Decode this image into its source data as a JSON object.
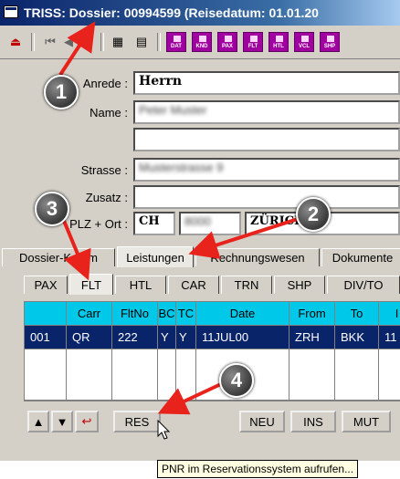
{
  "window": {
    "title": "TRISS: Dossier: 00994599 (Reisedatum: 01.01.20"
  },
  "toolbar": {
    "module_buttons": [
      "DAT",
      "KND",
      "PAX",
      "FLT",
      "HTL",
      "VCL",
      "SHP"
    ]
  },
  "form": {
    "anrede_label": "Anrede :",
    "anrede_value": "Herrn",
    "name_label": "Name :",
    "name_value": "Peter Muster",
    "name2_value": "",
    "strasse_label": "Strasse :",
    "strasse_value": "Musterstrasse 9",
    "zusatz_label": "Zusatz :",
    "zusatz_value": "",
    "plzort_label": "PLZ + Ort :",
    "country_value": "CH",
    "plz_value": "8000",
    "ort_value": "ZÜRICH"
  },
  "main_tabs": [
    "Dossier-Komm",
    "Leistungen",
    "Rechnungswesen",
    "Dokumente"
  ],
  "sub_tabs": [
    "PAX",
    "FLT",
    "HTL",
    "CAR",
    "TRN",
    "SHP",
    "DIV/TO"
  ],
  "grid": {
    "columns": [
      "",
      "Carr",
      "FltNo",
      "BC",
      "TC",
      "Date",
      "From",
      "To",
      "I"
    ],
    "rows": [
      [
        "001",
        "QR",
        "222",
        "Y",
        "Y",
        "11JUL00",
        "ZRH",
        "BKK",
        "11"
      ]
    ]
  },
  "buttons": {
    "res": "RES",
    "neu": "NEU",
    "ins": "INS",
    "mut": "MUT"
  },
  "tooltip": "PNR im Reservationssystem aufrufen...",
  "callouts": [
    "1",
    "2",
    "3",
    "4"
  ],
  "colors": {
    "title_bar": "#0a246a",
    "grid_header": "#00c8e8",
    "selected_row": "#0a246a",
    "arrow": "#e8231c",
    "module_button": "#a000a0"
  }
}
